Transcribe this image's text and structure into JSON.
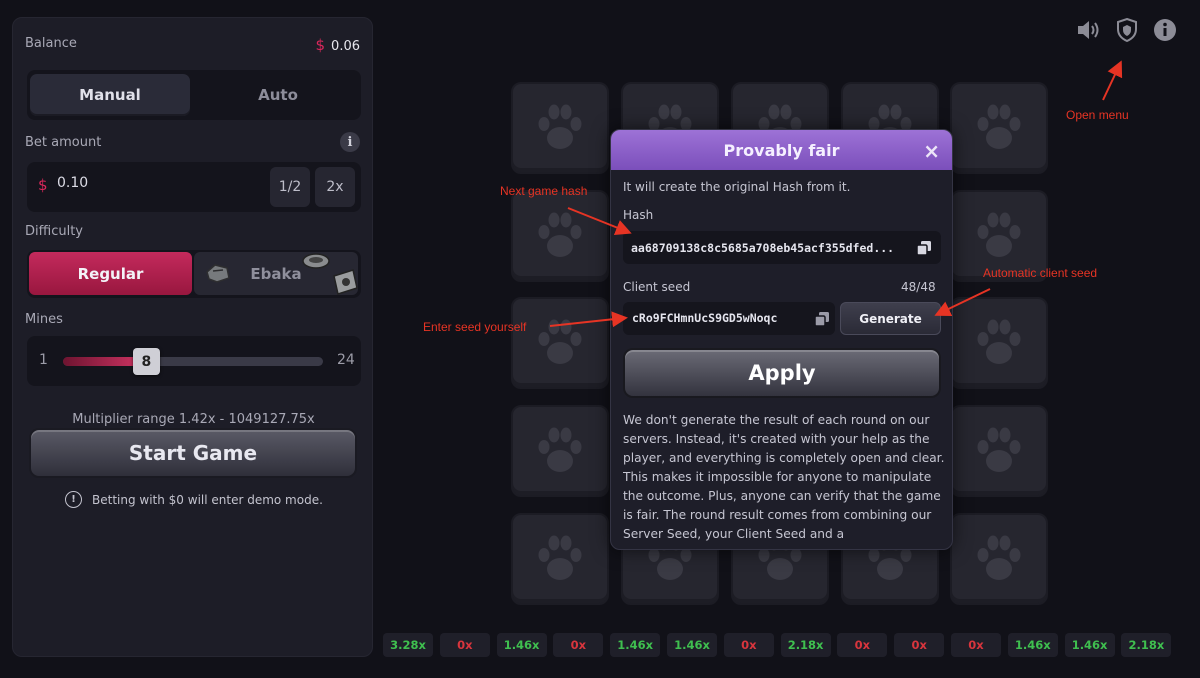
{
  "sidebar": {
    "balance_label": "Balance",
    "balance_currency": "$",
    "balance_value": "0.06",
    "mode_tabs": [
      "Manual",
      "Auto"
    ],
    "bet_label": "Bet amount",
    "bet_currency": "$",
    "bet_value": "0.10",
    "bet_half": "1/2",
    "bet_double": "2x",
    "difficulty_label": "Difficulty",
    "difficulty_options": [
      "Regular",
      "Ebaka"
    ],
    "mines_label": "Mines",
    "mines_min": "1",
    "mines_max": "24",
    "mines_value": "8",
    "mines_fraction": 0.3,
    "multiplier_range": "Multiplier range 1.42x - 1049127.75x",
    "start_button": "Start Game",
    "demo_notice": "Betting with $0 will enter demo mode.",
    "accent_color": "#c42a5c"
  },
  "modal": {
    "title": "Provably fair",
    "close": "×",
    "intro_text": "It will create the original Hash from it.",
    "hash_label": "Hash",
    "hash_value": "aa68709138c8c5685a708eb45acf355dfed...",
    "client_seed_label": "Client seed",
    "client_seed_count": "48/48",
    "client_seed_value": "cRo9FCHmnUcS9GD5wNoqc",
    "generate_button": "Generate",
    "apply_button": "Apply",
    "description": "We don't generate the result of each round on our servers. Instead, it's created with your help as the player, and everything is completely open and clear. This makes it impossible for anyone to manipulate the outcome. Plus, anyone can verify that the game is fair. The round result comes from combining our Server Seed, your Client Seed and a",
    "header_color": "#8d62c9"
  },
  "top_icons": [
    "speaker-icon",
    "shield-icon",
    "info-icon"
  ],
  "multiplier_history": [
    {
      "value": "3.28x",
      "status": "win"
    },
    {
      "value": "0x",
      "status": "loss"
    },
    {
      "value": "1.46x",
      "status": "win"
    },
    {
      "value": "0x",
      "status": "loss"
    },
    {
      "value": "1.46x",
      "status": "win"
    },
    {
      "value": "1.46x",
      "status": "win"
    },
    {
      "value": "0x",
      "status": "loss"
    },
    {
      "value": "2.18x",
      "status": "win"
    },
    {
      "value": "0x",
      "status": "loss"
    },
    {
      "value": "0x",
      "status": "loss"
    },
    {
      "value": "0x",
      "status": "loss"
    },
    {
      "value": "1.46x",
      "status": "win"
    },
    {
      "value": "1.46x",
      "status": "win"
    },
    {
      "value": "2.18x",
      "status": "win"
    }
  ],
  "annotations": {
    "open_menu": "Open menu",
    "next_game_hash": "Next game hash",
    "automatic_client_seed": "Automatic client seed",
    "enter_seed_yourself": "Enter seed yourself"
  }
}
